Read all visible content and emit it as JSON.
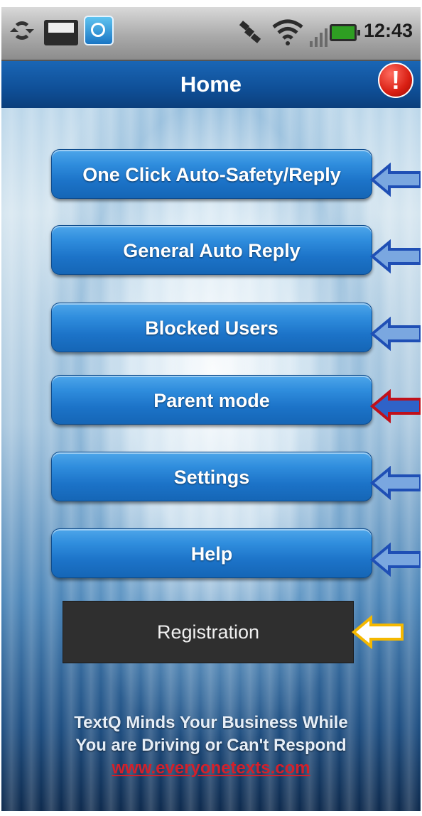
{
  "status_bar": {
    "time": "12:43",
    "icons": [
      "sync-icon",
      "mail-icon",
      "textq-app-icon",
      "gps-icon",
      "wifi-icon",
      "signal-icon",
      "battery-icon"
    ]
  },
  "header": {
    "title": "Home",
    "alert_icon": "!"
  },
  "menu": {
    "items": [
      {
        "label": "One Click Auto-Safety/Reply",
        "arrow_color": "#1f4fb5"
      },
      {
        "label": "General Auto Reply",
        "arrow_color": "#1f4fb5"
      },
      {
        "label": "Blocked Users",
        "arrow_color": "#1f4fb5"
      },
      {
        "label": "Parent mode",
        "arrow_color": "#c0101a"
      },
      {
        "label": "Settings",
        "arrow_color": "#1f4fb5"
      },
      {
        "label": "Help",
        "arrow_color": "#1f4fb5"
      }
    ],
    "registration": {
      "label": "Registration",
      "arrow_color": "#f5b800"
    }
  },
  "footer": {
    "line1": "TextQ Minds Your Business While",
    "line2": "You are Driving or Can't Respond",
    "link": "www.everyonetexts.com"
  },
  "colors": {
    "title_bar": "#0f4f97",
    "button": "#2f8ddd",
    "registration_bg": "#2f2f2f",
    "link": "#d4202a"
  }
}
